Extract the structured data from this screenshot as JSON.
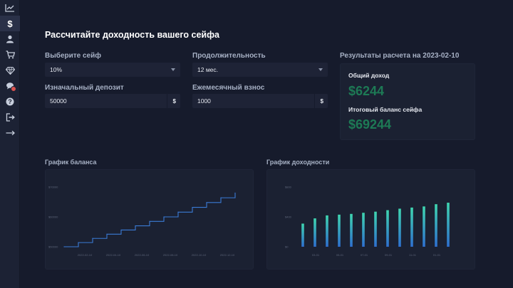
{
  "sidebar": {
    "items": [
      {
        "icon": "chart-line-icon",
        "active": false
      },
      {
        "icon": "dollar-icon",
        "active": true
      },
      {
        "icon": "user-icon",
        "active": false
      },
      {
        "icon": "cart-icon",
        "active": false
      },
      {
        "icon": "diamond-icon",
        "active": false
      },
      {
        "icon": "chat-icon",
        "active": false
      },
      {
        "icon": "help-icon",
        "active": false
      },
      {
        "icon": "logout-icon",
        "active": false
      },
      {
        "icon": "arrow-right-icon",
        "active": false
      }
    ]
  },
  "page": {
    "title": "Рассчитайте доходность вашего сейфа"
  },
  "form": {
    "safe_label": "Выберите сейф",
    "safe_value": "10%",
    "duration_label": "Продолжительность",
    "duration_value": "12 мес.",
    "deposit_label": "Изначальный депозит",
    "deposit_value": "50000",
    "deposit_currency": "$",
    "monthly_label": "Ежемесячный взнос",
    "monthly_value": "1000",
    "monthly_currency": "$"
  },
  "results": {
    "heading": "Результаты расчета на 2023-02-10",
    "income_label": "Общий доход",
    "income_value": "$6244",
    "balance_label": "Итоговый баланс сейфа",
    "balance_value": "$69244"
  },
  "charts": {
    "balance_title": "График баланса",
    "income_title": "График доходности"
  },
  "colors": {
    "accent_green": "#1d7a55",
    "line_blue": "#3a7bd5",
    "bar_top": "#3fd6b0",
    "bar_bottom": "#2e6fd0"
  },
  "chart_data": [
    {
      "type": "line",
      "title": "",
      "xlabel": "",
      "ylabel": "",
      "y_ticks": [
        "$70000",
        "$60000",
        "$50000"
      ],
      "x_ticks": [
        "2022-02-10",
        "2022-04-10",
        "2022-06-10",
        "2022-08-10",
        "2022-10-10",
        "2022-12-10"
      ],
      "ylim": [
        50000,
        70000
      ],
      "x": [
        0,
        1,
        2,
        3,
        4,
        5,
        6,
        7,
        8,
        9,
        10,
        11,
        12
      ],
      "values": [
        50000,
        51400,
        52800,
        54200,
        55600,
        57000,
        58500,
        60000,
        61600,
        63200,
        64800,
        66400,
        68000
      ],
      "grid": false
    },
    {
      "type": "bar",
      "title": "",
      "y_ticks": [
        "$800",
        "$400",
        "$0"
      ],
      "x_ticks": [
        "03-01",
        "05-01",
        "07-01",
        "09-01",
        "11-01",
        "01-01"
      ],
      "ylim": [
        0,
        800
      ],
      "values": [
        310,
        380,
        420,
        430,
        440,
        455,
        470,
        490,
        510,
        525,
        540,
        570,
        590
      ],
      "grid": false
    }
  ]
}
